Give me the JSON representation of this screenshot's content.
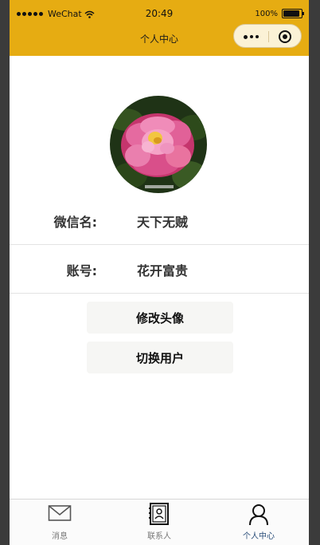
{
  "status_bar": {
    "carrier": "WeChat",
    "time": "20:49",
    "battery": "100%"
  },
  "nav": {
    "title": "个人中心"
  },
  "profile": {
    "wechat_name_label": "微信名:",
    "wechat_name_value": "天下无贼",
    "account_label": "账号:",
    "account_value": "花开富贵"
  },
  "actions": {
    "change_avatar": "修改头像",
    "switch_user": "切换用户"
  },
  "tabbar": {
    "items": [
      {
        "label": "消息",
        "icon": "mail-icon",
        "active": false
      },
      {
        "label": "联系人",
        "icon": "contacts-icon",
        "active": false
      },
      {
        "label": "个人中心",
        "icon": "user-icon",
        "active": true
      }
    ]
  },
  "colors": {
    "accent": "#e6ac12",
    "tab_active": "#2a4e7a"
  }
}
